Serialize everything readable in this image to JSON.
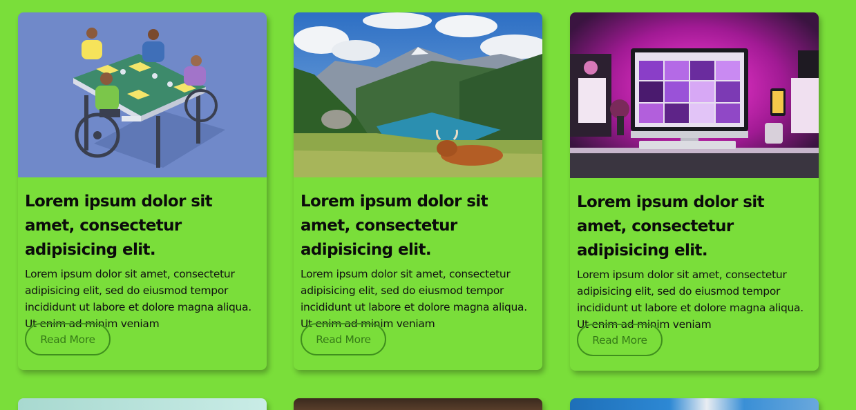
{
  "cards": [
    {
      "title": "Lorem ipsum dolor sit amet, consectetur adipisicing elit.",
      "text": "Lorem ipsum dolor sit amet, consectetur adipisicing elit, sed do eiusmod tempor incididunt ut labore et dolore magna aliqua. Ut enim ad minim veniam",
      "button": "Read More",
      "image": "people-playing-board-game-illustration"
    },
    {
      "title": "Lorem ipsum dolor sit amet, consectetur adipisicing elit.",
      "text": "Lorem ipsum dolor sit amet, consectetur adipisicing elit, sed do eiusmod tempor incididunt ut labore et dolore magna aliqua. Ut enim ad minim veniam",
      "button": "Read More",
      "image": "mountain-lake-highland-cow-photo"
    },
    {
      "title": "Lorem ipsum dolor sit amet, consectetur adipisicing elit.",
      "text": "Lorem ipsum dolor sit amet, consectetur adipisicing elit, sed do eiusmod tempor incididunt ut labore et dolore magna aliqua. Ut enim ad minim veniam",
      "button": "Read More",
      "image": "desk-computer-pink-light-photo"
    }
  ],
  "colors": {
    "background": "#7ade3a",
    "button_border": "#3f8f1d",
    "button_text": "#357a17"
  }
}
